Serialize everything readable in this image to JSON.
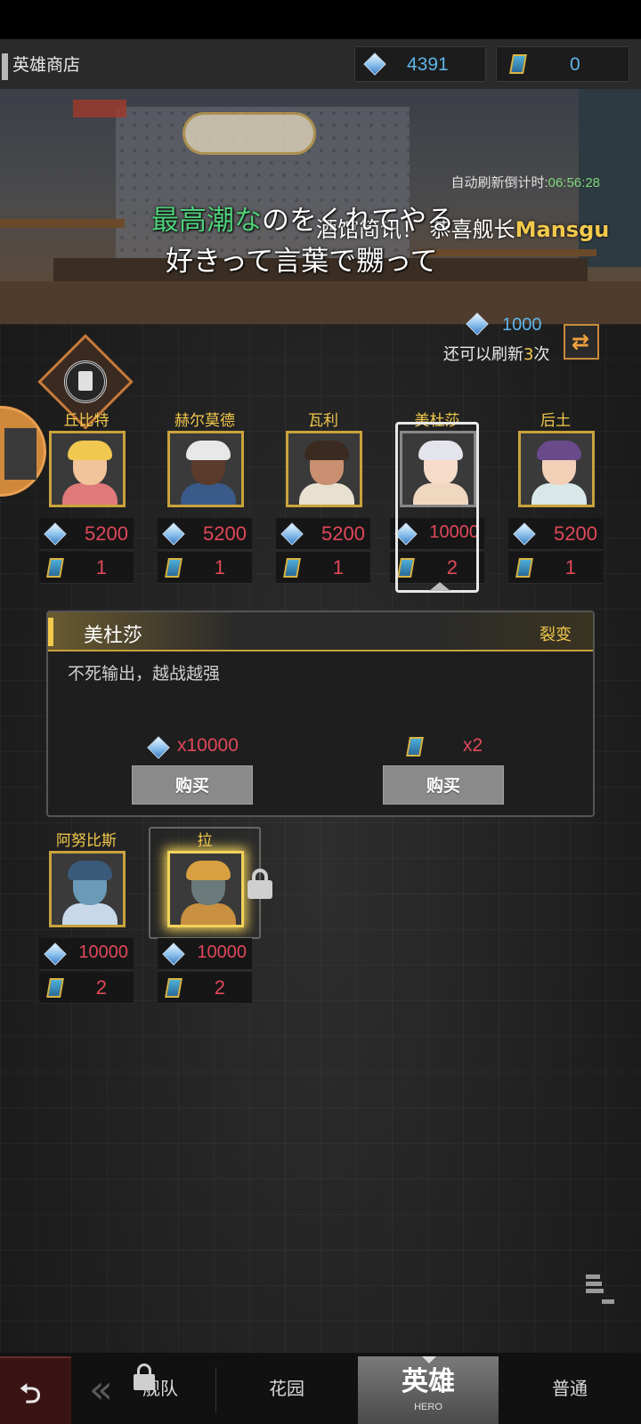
{
  "header": {
    "title": "英雄商店",
    "gems": "4391",
    "scrolls": "0"
  },
  "scene": {
    "countdown_label": "自动刷新倒计时:",
    "countdown_time": "06:56:28",
    "lyric_line1_highlight": "最高潮な",
    "lyric_line1_rest": "のをくれてやる",
    "lyric_line2": "好きって言葉で嬲って",
    "news_text": "酒馆简讯！ 恭喜舰长",
    "news_captain": "Mansgu"
  },
  "refresh": {
    "cost": "1000",
    "remaining_prefix": "还可以刷新",
    "remaining_count": "3",
    "remaining_suffix": "次"
  },
  "heroes": [
    {
      "name": "丘比特",
      "gem_price": "5200",
      "scroll_price": "1"
    },
    {
      "name": "赫尔莫德",
      "gem_price": "5200",
      "scroll_price": "1"
    },
    {
      "name": "瓦利",
      "gem_price": "5200",
      "scroll_price": "1"
    },
    {
      "name": "美杜莎",
      "gem_price": "10000",
      "scroll_price": "2"
    },
    {
      "name": "后土",
      "gem_price": "5200",
      "scroll_price": "1"
    },
    {
      "name": "阿努比斯",
      "gem_price": "10000",
      "scroll_price": "2"
    },
    {
      "name": "拉",
      "gem_price": "10000",
      "scroll_price": "2"
    }
  ],
  "detail": {
    "name": "美杜莎",
    "tag": "裂变",
    "description": "不死输出，越战越强",
    "gem_cost": "x10000",
    "scroll_cost": "x2",
    "buy_label": "购买"
  },
  "nav": {
    "tabs": [
      {
        "label": "舰队"
      },
      {
        "label": "花园"
      },
      {
        "label": "英雄",
        "sub": "HERO"
      },
      {
        "label": "普通"
      }
    ]
  },
  "colors": {
    "accent_gold": "#f2c94c",
    "price_red": "#e0485a",
    "currency_blue": "#5fb4e8",
    "countdown_green": "#7dd87a"
  }
}
